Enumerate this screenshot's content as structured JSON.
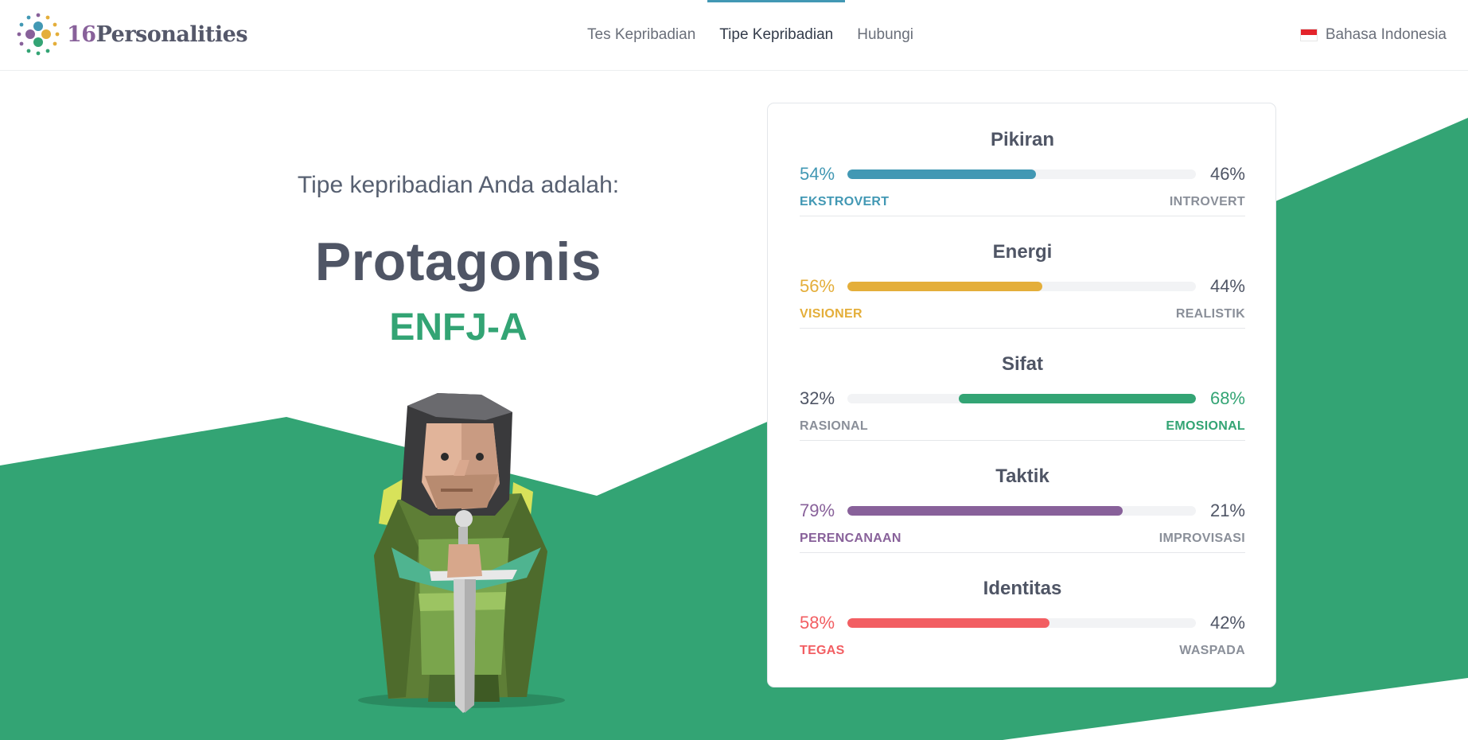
{
  "header": {
    "brand_number": "16",
    "brand_name": "Personalities",
    "nav": [
      {
        "label": "Tes Kepribadian",
        "active": false
      },
      {
        "label": "Tipe Kepribadian",
        "active": true
      },
      {
        "label": "Hubungi",
        "active": false
      }
    ],
    "language": "Bahasa Indonesia"
  },
  "hero": {
    "subtitle": "Tipe kepribadian Anda adalah:",
    "type_name": "Protagonis",
    "type_code": "ENFJ-A"
  },
  "colors": {
    "accent_green": "#33a474",
    "mind_blue": "#4298b4",
    "energy_yellow": "#e4ae3a",
    "nature_green": "#33a474",
    "tactics_purple": "#88619a",
    "identity_red": "#f25e62"
  },
  "traits": [
    {
      "title": "Pikiran",
      "left_pct": "54%",
      "right_pct": "46%",
      "left_label": "EKSTROVERT",
      "right_label": "INTROVERT",
      "fill_side": "left",
      "fill_fraction": 0.54,
      "color": "#4298b4"
    },
    {
      "title": "Energi",
      "left_pct": "56%",
      "right_pct": "44%",
      "left_label": "VISIONER",
      "right_label": "REALISTIK",
      "fill_side": "left",
      "fill_fraction": 0.56,
      "color": "#e4ae3a"
    },
    {
      "title": "Sifat",
      "left_pct": "32%",
      "right_pct": "68%",
      "left_label": "RASIONAL",
      "right_label": "EMOSIONAL",
      "fill_side": "right",
      "fill_fraction": 0.68,
      "color": "#33a474"
    },
    {
      "title": "Taktik",
      "left_pct": "79%",
      "right_pct": "21%",
      "left_label": "PERENCANAAN",
      "right_label": "IMPROVISASI",
      "fill_side": "left",
      "fill_fraction": 0.79,
      "color": "#88619a"
    },
    {
      "title": "Identitas",
      "left_pct": "58%",
      "right_pct": "42%",
      "left_label": "TEGAS",
      "right_label": "WASPADA",
      "fill_side": "left",
      "fill_fraction": 0.58,
      "color": "#f25e62"
    }
  ]
}
